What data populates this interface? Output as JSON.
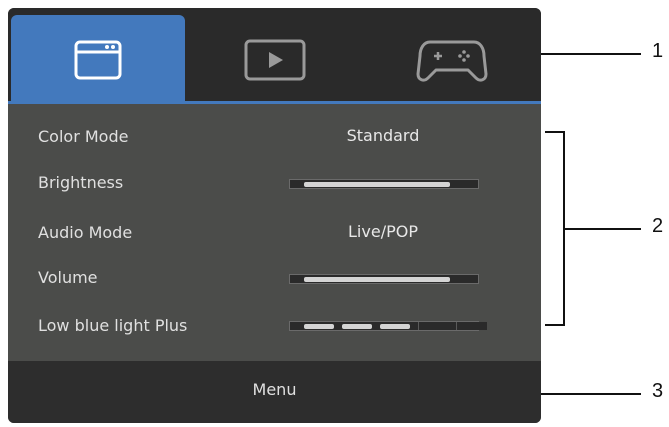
{
  "tabs": [
    {
      "icon": "window-icon",
      "active": true
    },
    {
      "icon": "play-icon",
      "active": false
    },
    {
      "icon": "gamepad-icon",
      "active": false
    }
  ],
  "settings": {
    "color_mode": {
      "label": "Color Mode",
      "value": "Standard"
    },
    "brightness": {
      "label": "Brightness",
      "level": 0.88
    },
    "audio_mode": {
      "label": "Audio Mode",
      "value": "Live/POP"
    },
    "volume": {
      "label": "Volume",
      "level": 0.88
    },
    "low_blue_light": {
      "label": "Low blue light Plus",
      "level_steps": 3,
      "max_steps": 5
    }
  },
  "footer": {
    "label": "Menu"
  },
  "callouts": [
    "1",
    "2",
    "3"
  ],
  "colors": {
    "accent": "#4379bd",
    "panel": "#4b4c4a",
    "dark": "#2a2a2a"
  }
}
